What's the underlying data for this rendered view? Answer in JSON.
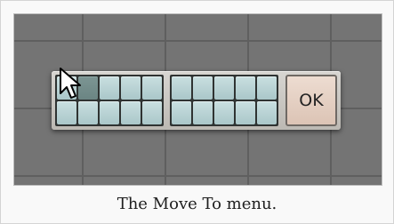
{
  "menu": {
    "group_one": {
      "rows": 2,
      "columns": 5,
      "selected_cell": {
        "row": 1,
        "column": 2
      }
    },
    "group_two": {
      "rows": 2,
      "columns": 5
    },
    "ok_label": "OK"
  },
  "caption": "The Move To menu.",
  "icons": {
    "cursor": "mouse-pointer-icon"
  },
  "colors": {
    "cell": "#b7d3d4",
    "selected_cell": "#728c8a",
    "ok_button": "#e5d0c3",
    "background": "#747474"
  }
}
